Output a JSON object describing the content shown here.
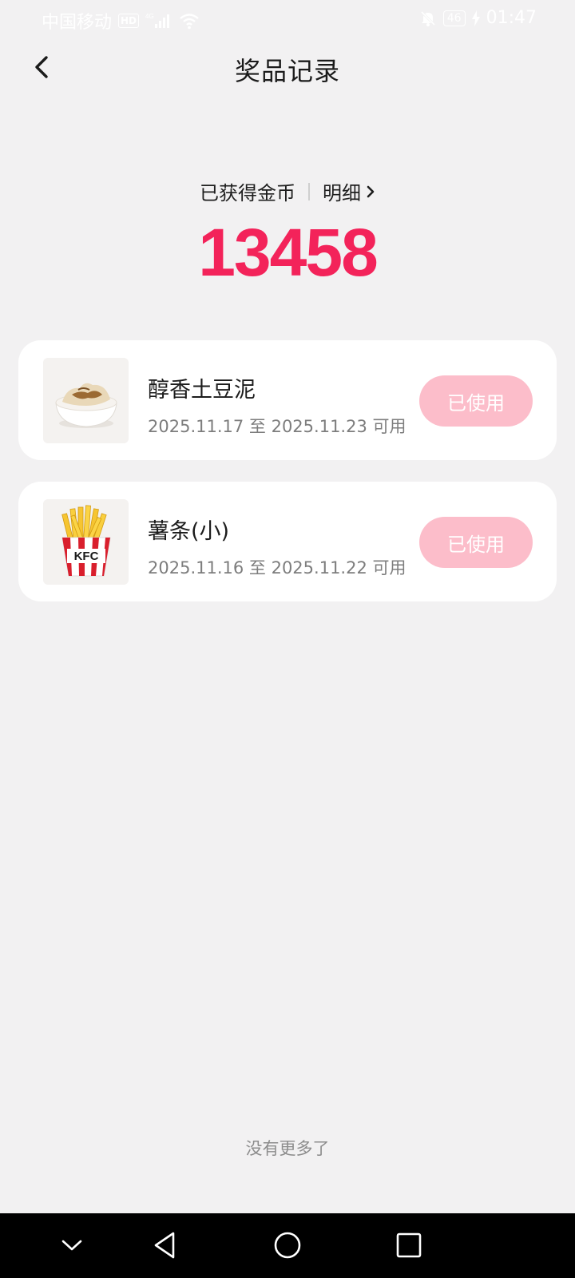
{
  "status_bar": {
    "carrier": "中国移动",
    "hd": "HD",
    "network": "4G",
    "battery": "46",
    "time": "01:47"
  },
  "header": {
    "title": "奖品记录",
    "back_icon": "chevron-left-icon"
  },
  "coins": {
    "label": "已获得金币",
    "detail_label": "明细",
    "value": "13458",
    "value_color": "#f3235a"
  },
  "prizes": [
    {
      "name": "醇香土豆泥",
      "dates": "2025.11.17 至 2025.11.23 可用",
      "status": "已使用",
      "image": "mashed-potato-bowl"
    },
    {
      "name": "薯条(小)",
      "dates": "2025.11.16 至 2025.11.22 可用",
      "status": "已使用",
      "image": "french-fries-box"
    }
  ],
  "fries_box_logo": "KFC",
  "footer": {
    "no_more": "没有更多了"
  },
  "colors": {
    "accent": "#f3235a",
    "used_button": "#fcbdca",
    "background": "#f2f1f2"
  }
}
